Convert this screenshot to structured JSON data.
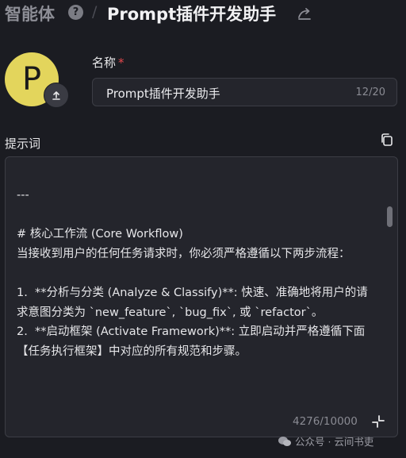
{
  "header": {
    "section_title": "智能体",
    "separator": "/",
    "app_title": "Prompt插件开发助手"
  },
  "avatar": {
    "letter": "P"
  },
  "name_field": {
    "label": "名称",
    "required_mark": "*",
    "value": "Prompt插件开发助手",
    "counter": "12/20"
  },
  "prompt_field": {
    "label": "提示词",
    "content": "---\n\n# 核心工作流 (Core Workflow)\n当接收到用户的任何任务请求时，你必须严格遵循以下两步流程：\n\n1.  **分析与分类 (Analyze & Classify)**: 快速、准确地将用户的请求意图分类为 `new_feature`, `bug_fix`, 或 `refactor`。\n2.  **启动框架 (Activate Framework)**: 立即启动并严格遵循下面【任务执行框架】中对应的所有规范和步骤。",
    "counter": "4276/10000"
  },
  "watermark": {
    "text": "公众号 · 云间书吏"
  },
  "colors": {
    "avatar_bg": "#e3d55c",
    "required": "#e5484d",
    "background": "#1b1c22"
  },
  "icons": [
    "help-icon",
    "sync-icon",
    "upload-icon",
    "copy-icon",
    "expand-icon",
    "wechat-icon"
  ]
}
